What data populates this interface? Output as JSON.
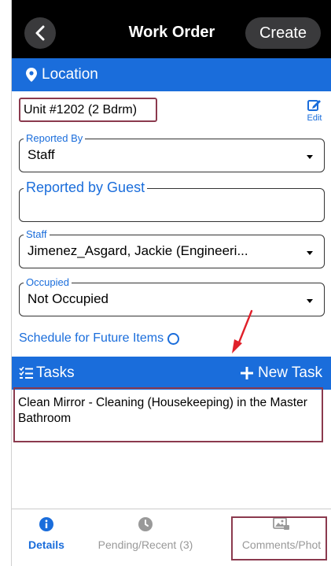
{
  "header": {
    "title": "Work Order",
    "create_label": "Create"
  },
  "location": {
    "section_label": "Location",
    "unit": "Unit #1202 (2 Bdrm)",
    "edit_label": "Edit"
  },
  "fields": {
    "reported_by": {
      "legend": "Reported By",
      "value": "Staff"
    },
    "reported_by_guest": {
      "legend": "Reported by Guest",
      "value": ""
    },
    "staff": {
      "legend": "Staff",
      "value": "Jimenez_Asgard, Jackie (Engineeri..."
    },
    "occupied": {
      "legend": "Occupied",
      "value": "Not Occupied"
    }
  },
  "schedule": {
    "label": "Schedule for Future Items"
  },
  "tasks": {
    "section_label": "Tasks",
    "new_task_label": "New Task",
    "items": [
      {
        "text": "Clean Mirror - Cleaning (Housekeeping) in the Master Bathroom"
      }
    ]
  },
  "tabs": [
    {
      "label": "Details",
      "icon": "info-icon",
      "active": true
    },
    {
      "label": "Pending/Recent (3)",
      "icon": "clock-icon",
      "active": false
    },
    {
      "label": "Comments/Phot",
      "icon": "photo-icon",
      "active": false
    }
  ],
  "colors": {
    "accent": "#1a6ddb",
    "highlight": "#8b3a4e",
    "annotation_arrow": "#e0202a"
  }
}
